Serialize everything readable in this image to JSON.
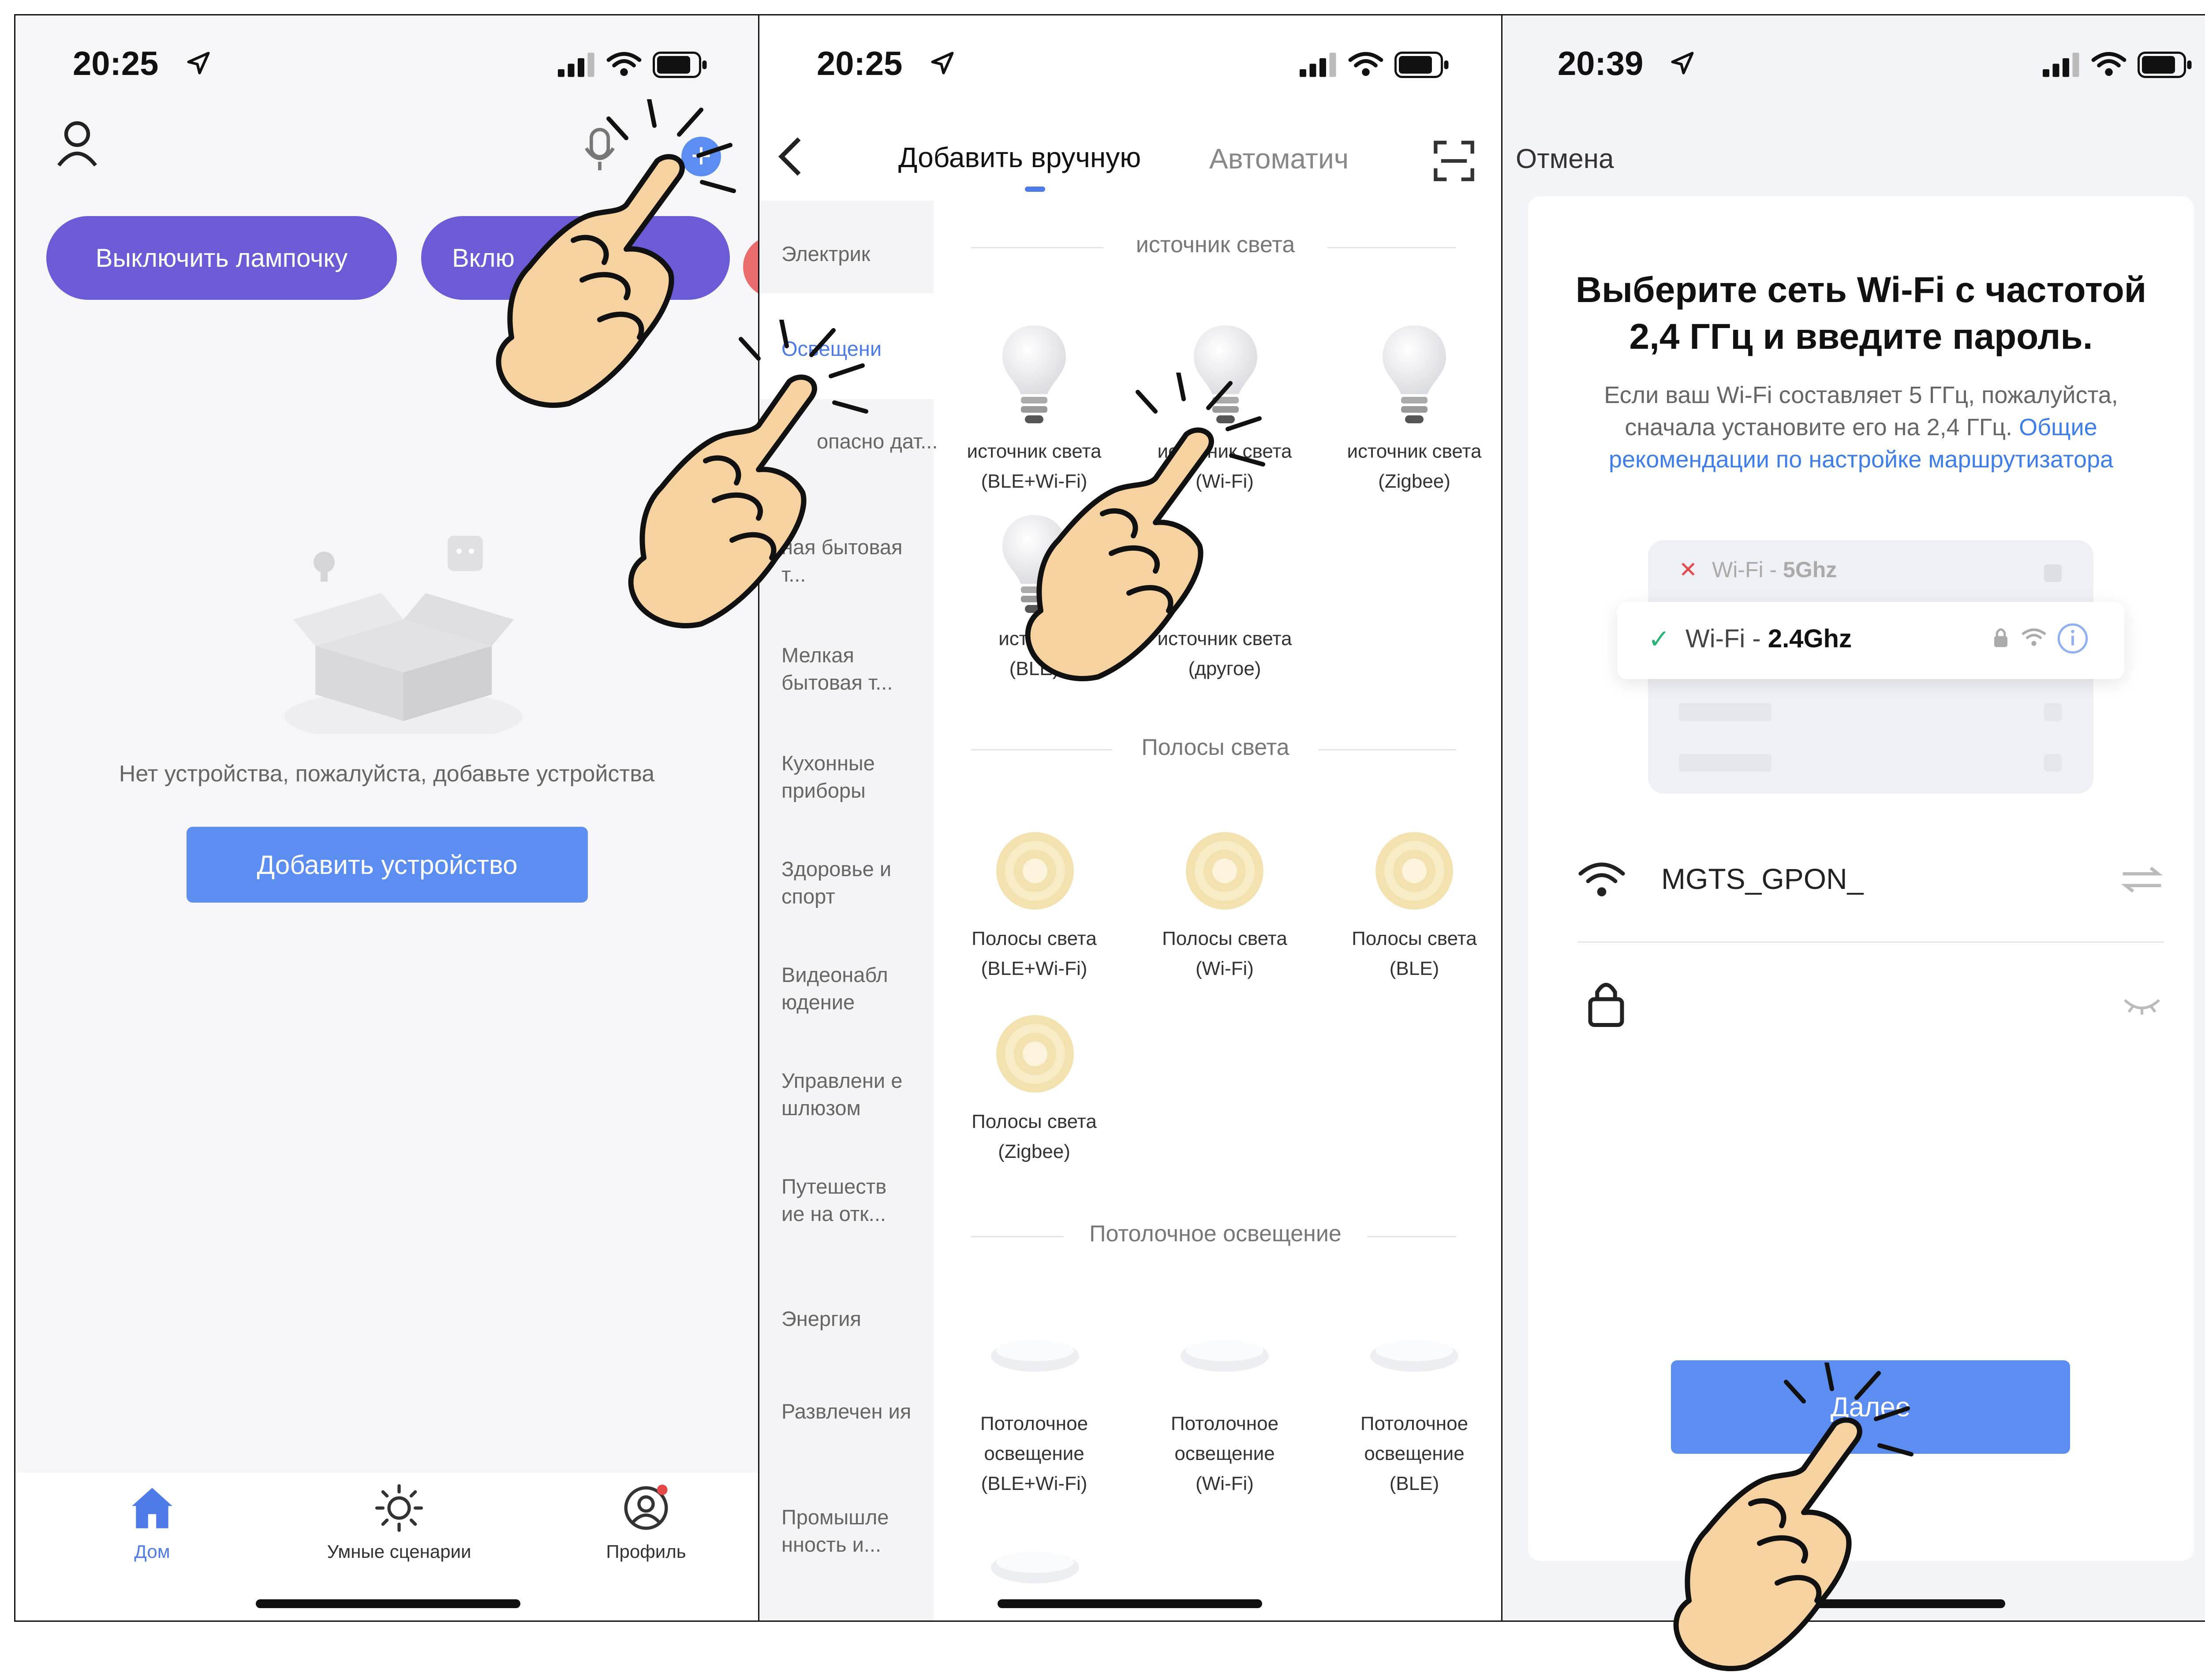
{
  "pane1": {
    "time": "20:25",
    "chips": [
      "Выключить лампочку",
      "Вклю"
    ],
    "empty_text": "Нет устройства, пожалуйста, добавьте устройства",
    "add_button": "Добавить устройство",
    "tabs": [
      {
        "label": "Дом",
        "icon": "home-icon",
        "active": true
      },
      {
        "label": "Умные сценарии",
        "icon": "sun-icon",
        "active": false
      },
      {
        "label": "Профиль",
        "icon": "profile-icon",
        "active": false
      }
    ],
    "colors": {
      "accent": "#6b5bd6",
      "blue": "#5b8ef0",
      "active_tab": "#4f7be8"
    }
  },
  "pane2": {
    "time": "20:25",
    "tab_manual": "Добавить вручную",
    "tab_auto": "Автоматич",
    "categories": [
      "Электрик",
      "Освещени",
      "опасно дат...",
      "ная бытовая т...",
      "Мелкая бытовая т...",
      "Кухонные приборы",
      "Здоровье и спорт",
      "Видеонабл юдение",
      "Управлени е шлюзом",
      "Путешеств ие на отк...",
      "Энергия",
      "Развлечен ия",
      "Промышле нность и..."
    ],
    "sections": [
      {
        "title": "источник света",
        "items": [
          [
            "источник света",
            "(BLE+Wi-Fi)"
          ],
          [
            "источник света",
            "(Wi-Fi)"
          ],
          [
            "источник света",
            "(Zigbee)"
          ],
          [
            "источни",
            "(BLE)"
          ],
          [
            "источник света",
            "(другое)"
          ]
        ]
      },
      {
        "title": "Полосы света",
        "items": [
          [
            "Полосы света",
            "(BLE+Wi-Fi)"
          ],
          [
            "Полосы света",
            "(Wi-Fi)"
          ],
          [
            "Полосы света",
            "(BLE)"
          ],
          [
            "Полосы света",
            "(Zigbee)"
          ]
        ]
      },
      {
        "title": "Потолочное освещение",
        "items": [
          [
            "Потолочное",
            "освещение",
            "(BLE+Wi-Fi)"
          ],
          [
            "Потолочное",
            "освещение",
            "(Wi-Fi)"
          ],
          [
            "Потолочное",
            "освещение",
            "(BLE)"
          ]
        ]
      }
    ],
    "colors": {
      "active": "#4f7be8"
    }
  },
  "pane3": {
    "time": "20:39",
    "cancel": "Отмена",
    "title_line1": "Выберите сеть Wi-Fi с частотой",
    "title_line2": "2,4 ГГц и введите пароль.",
    "desc_line1": "Если ваш Wi-Fi составляет 5 ГГц, пожалуйста,",
    "desc_line2": "сначала установите его на 2,4 ГГц.",
    "desc_link_a": "Общие",
    "desc_link_b": "рекомендации по настройке маршрутизатора",
    "wifi_bad_prefix": "Wi-Fi - ",
    "wifi_bad_band": "5Ghz",
    "wifi_good_prefix": "Wi-Fi - ",
    "wifi_good_band": "2.4Ghz",
    "ssid": "MGTS_GPON_",
    "next_button": "Далее",
    "colors": {
      "link": "#3f7ee8",
      "button": "#5b8ef0",
      "ok": "#2bb57a",
      "bad": "#e54848"
    }
  }
}
